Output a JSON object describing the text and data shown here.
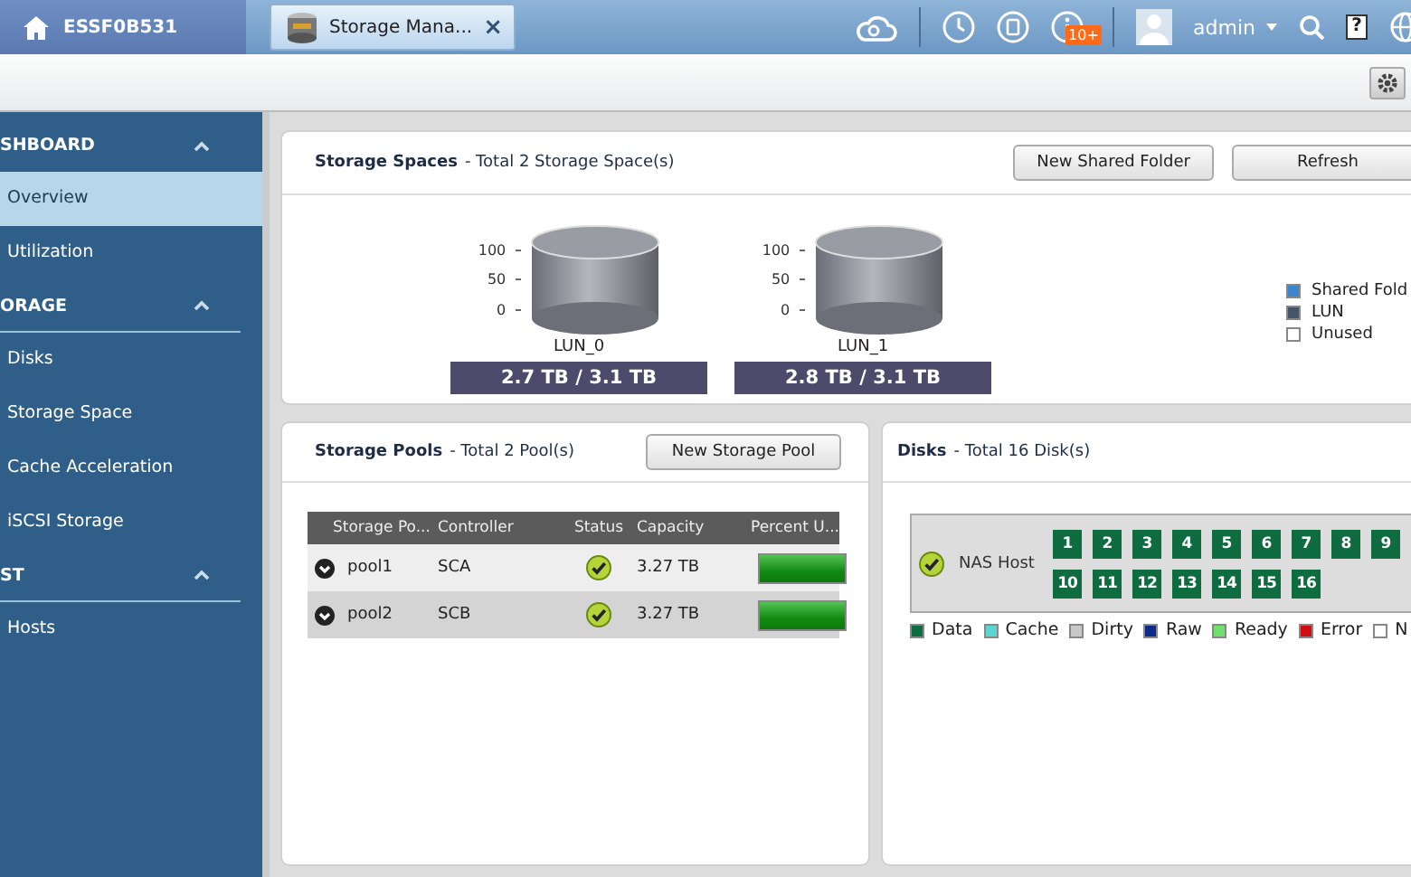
{
  "topbar": {
    "home_label": "ESSF0B531",
    "tabs": [
      {
        "label": "Storage Mana...",
        "close": "×",
        "selected": true
      }
    ],
    "notification_badge": "10+",
    "user": "admin",
    "help": "?"
  },
  "sidebar": {
    "sections": [
      {
        "title": "SHBOARD",
        "expanded": true,
        "items": [
          {
            "label": "Overview",
            "selected": true
          },
          {
            "label": "Utilization",
            "selected": false
          }
        ]
      },
      {
        "title": "ORAGE",
        "expanded": true,
        "items": [
          {
            "label": "Disks",
            "selected": false
          },
          {
            "label": "Storage Space",
            "selected": false
          },
          {
            "label": "Cache Acceleration",
            "selected": false
          },
          {
            "label": "iSCSI Storage",
            "selected": false
          }
        ]
      },
      {
        "title": "ST",
        "expanded": true,
        "items": [
          {
            "label": "Hosts",
            "selected": false
          }
        ]
      }
    ]
  },
  "storage_spaces": {
    "title": "Storage Spaces",
    "subtitle": "- Total 2 Storage Space(s)",
    "buttons": [
      "New Shared Folder",
      "Refresh"
    ],
    "luns": [
      {
        "name": "LUN_0",
        "ticks": [
          "100",
          "50",
          "0"
        ],
        "usage": "2.7 TB / 3.1 TB"
      },
      {
        "name": "LUN_1",
        "ticks": [
          "100",
          "50",
          "0"
        ],
        "usage": "2.8 TB / 3.1 TB"
      }
    ],
    "legend": [
      {
        "label": "Shared Fold",
        "color": "#3a87d0"
      },
      {
        "label": "LUN",
        "color": "#44546a"
      },
      {
        "label": "Unused",
        "color": "#ffffff"
      }
    ]
  },
  "storage_pools": {
    "title": "Storage Pools",
    "subtitle": "- Total 2 Pool(s)",
    "button": "New Storage Pool",
    "columns": [
      "Storage Po...",
      "Controller",
      "Status",
      "Capacity",
      "Percent U..."
    ],
    "rows": [
      {
        "name": "pool1",
        "controller": "SCA",
        "status_ok": true,
        "capacity": "3.27 TB",
        "level": 1.0,
        "selected": false
      },
      {
        "name": "pool2",
        "controller": "SCB",
        "status_ok": true,
        "capacity": "3.27 TB",
        "level": 1.0,
        "selected": true
      }
    ]
  },
  "disks": {
    "title": "Disks",
    "subtitle": "- Total 16 Disk(s)",
    "host": {
      "label": "NAS Host",
      "status_ok": true
    },
    "slots": [
      {
        "label": "1",
        "color": "#0f6b40"
      },
      {
        "label": "2",
        "color": "#0f6b40"
      },
      {
        "label": "3",
        "color": "#0f6b40"
      },
      {
        "label": "4",
        "color": "#0f6b40"
      },
      {
        "label": "5",
        "color": "#0f6b40"
      },
      {
        "label": "6",
        "color": "#0f6b40"
      },
      {
        "label": "7",
        "color": "#0f6b40"
      },
      {
        "label": "8",
        "color": "#0f6b40"
      },
      {
        "label": "9",
        "color": "#0f6b40"
      },
      {
        "label": "10",
        "color": "#0f6b40"
      },
      {
        "label": "11",
        "color": "#0f6b40"
      },
      {
        "label": "12",
        "color": "#0f6b40"
      },
      {
        "label": "13",
        "color": "#0f6b40"
      },
      {
        "label": "14",
        "color": "#0f6b40"
      },
      {
        "label": "15",
        "color": "#0f6b40"
      },
      {
        "label": "16",
        "color": "#0f6b40"
      }
    ],
    "legend": [
      {
        "label": "Data",
        "color": "#0f6b40"
      },
      {
        "label": "Cache",
        "color": "#5cd6d0"
      },
      {
        "label": "Dirty",
        "color": "#c8c8c8"
      },
      {
        "label": "Raw",
        "color": "#102a8a"
      },
      {
        "label": "Ready",
        "color": "#6ee06e"
      },
      {
        "label": "Error",
        "color": "#d01010"
      },
      {
        "label": "N",
        "color": "#ffffff"
      }
    ]
  }
}
